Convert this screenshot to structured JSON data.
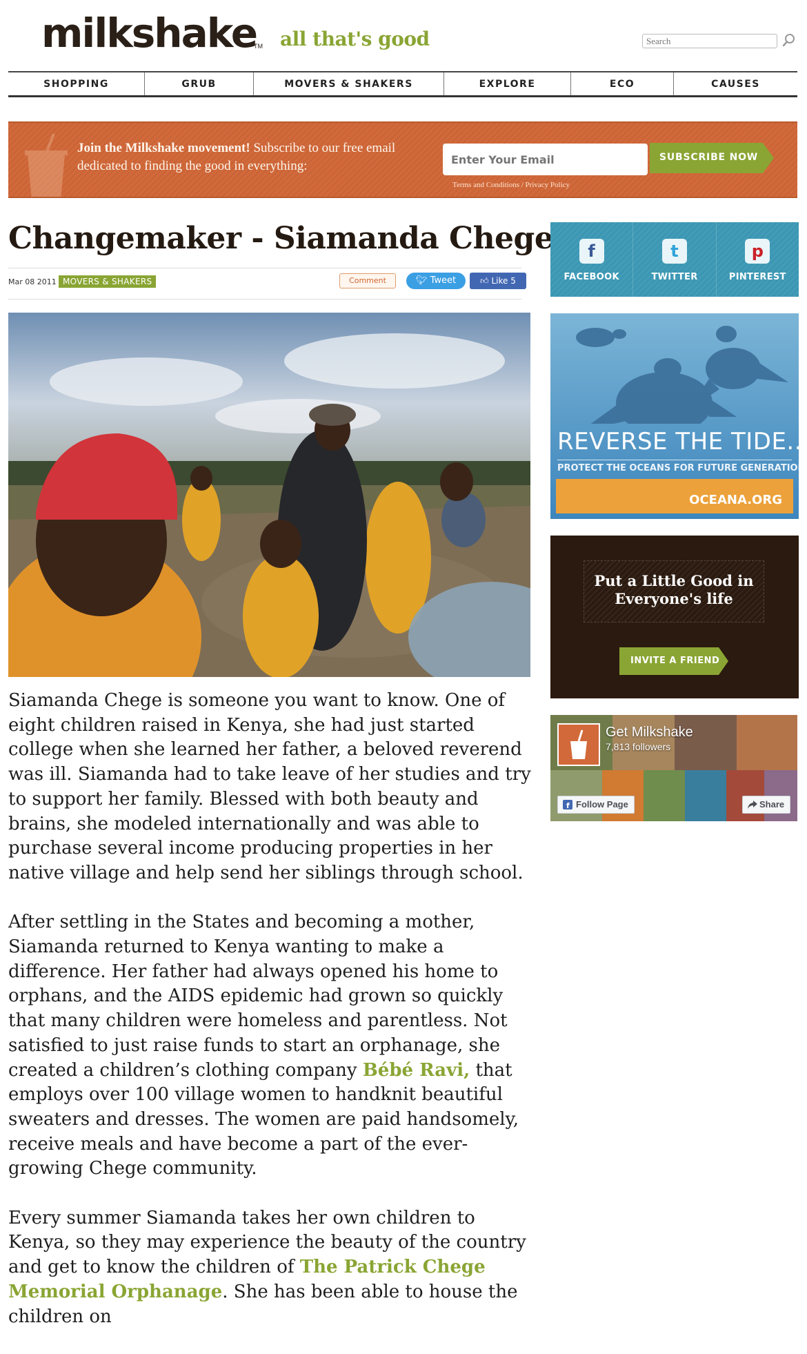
{
  "header": {
    "logo": "milkshake",
    "logo_tm": "TM",
    "tagline": "all that's good",
    "search_placeholder": "Search"
  },
  "nav": [
    "SHOPPING",
    "GRUB",
    "MOVERS & SHAKERS",
    "EXPLORE",
    "ECO",
    "CAUSES"
  ],
  "banner": {
    "lead": "Join the Milkshake movement!",
    "text": " Subscribe to our free email dedicated to finding the good in everything:",
    "email_placeholder": "Enter Your Email",
    "terms": "Terms and Conditions / Privacy Policy",
    "subscribe_label": "SUBSCRIBE NOW"
  },
  "article": {
    "title": "Changemaker - Siamanda Chege",
    "date": "Mar 08 2011",
    "category": "MOVERS & SHAKERS",
    "comment_label": "Comment",
    "tweet_label": "Tweet",
    "like_label": "Like 5",
    "p1": "Siamanda Chege is someone you want to know. One of eight children raised in Kenya, she had just started college when she learned her father, a beloved reverend was ill. Siamanda had to take leave of her studies and try to support her family. Blessed with both beauty and brains, she modeled internationally and was able to purchase several income producing properties in her native village and help send her siblings through school.",
    "p2_a": "After settling in the States and becoming a mother, Siamanda returned to Kenya wanting to make a difference. Her father had always opened his home to orphans, and the AIDS epidemic had grown so quickly that many children were homeless and parentless. Not satisfied to just raise funds to start an orphanage, she created a children’s clothing company ",
    "p2_link": "Bébé Ravi,",
    "p2_b": " that employs over 100 village women to handknit beautiful sweaters and dresses. The women are paid handsomely, receive meals and have become a part of the ever-growing Chege community.",
    "p3_a": "Every summer Siamanda takes her own children to Kenya, so they may experience the beauty of the country and get to know the children of ",
    "p3_link": "The Patrick Chege Memorial Orphanage",
    "p3_b": ". She has been able to house the children on"
  },
  "sidebar": {
    "social": [
      {
        "label": "FACEBOOK",
        "glyph": "f",
        "icon": "facebook-icon",
        "color": "#3b5998"
      },
      {
        "label": "TWITTER",
        "glyph": "t",
        "icon": "twitter-icon",
        "color": "#2fa3d9"
      },
      {
        "label": "PINTEREST",
        "glyph": "p",
        "icon": "pinterest-icon",
        "color": "#cb2027"
      }
    ],
    "oceana": {
      "headline": "REVERSE THE TIDE...",
      "sub": "PROTECT THE OCEANS FOR FUTURE GENERATIONS",
      "brand": "OCEANA.ORG"
    },
    "invite": {
      "text": "Put a Little Good in Everyone's life",
      "button": "INVITE A FRIEND"
    },
    "fb": {
      "name": "Get Milkshake",
      "followers": "7,813 followers",
      "follow_label": "Follow Page",
      "share_label": "Share"
    }
  },
  "colors": {
    "brand_green": "#8aa534",
    "banner_orange": "#d2693a",
    "social_blue": "#3b97b4",
    "invite_brown": "#2b1a0f"
  }
}
